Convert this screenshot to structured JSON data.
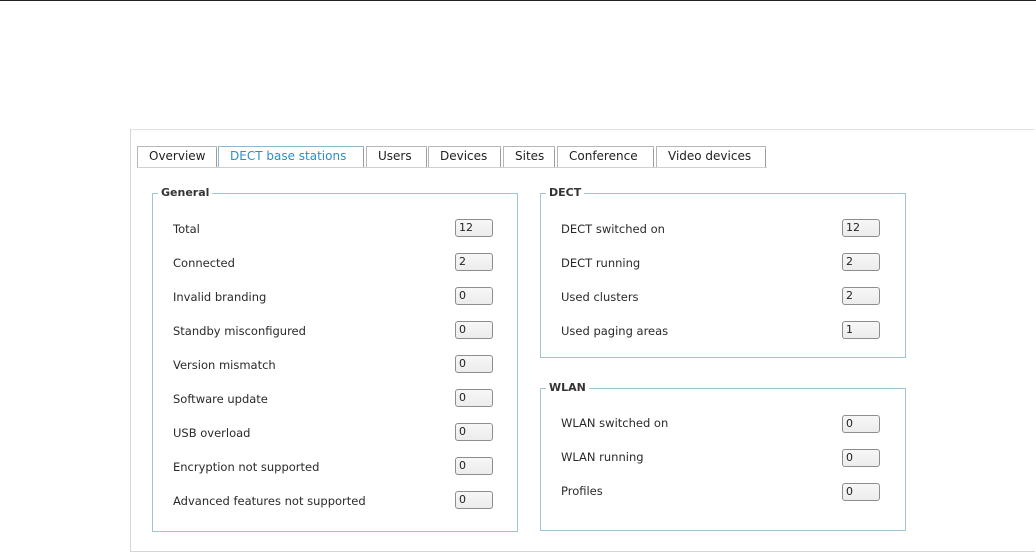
{
  "tabs": [
    {
      "label": "Overview",
      "active": false
    },
    {
      "label": "DECT base stations",
      "active": true
    },
    {
      "label": "Users",
      "active": false
    },
    {
      "label": "Devices",
      "active": false
    },
    {
      "label": "Sites",
      "active": false
    },
    {
      "label": "Conference",
      "active": false
    },
    {
      "label": "Video devices",
      "active": false
    }
  ],
  "general": {
    "title": "General",
    "rows": [
      {
        "label": "Total",
        "value": "12"
      },
      {
        "label": "Connected",
        "value": "2"
      },
      {
        "label": "Invalid branding",
        "value": "0"
      },
      {
        "label": "Standby misconfigured",
        "value": "0"
      },
      {
        "label": "Version mismatch",
        "value": "0"
      },
      {
        "label": "Software update",
        "value": "0"
      },
      {
        "label": "USB overload",
        "value": "0"
      },
      {
        "label": "Encryption not supported",
        "value": "0"
      },
      {
        "label": "Advanced features not supported",
        "value": "0"
      }
    ]
  },
  "dect": {
    "title": "DECT",
    "rows": [
      {
        "label": "DECT switched on",
        "value": "12"
      },
      {
        "label": "DECT running",
        "value": "2"
      },
      {
        "label": "Used clusters",
        "value": "2"
      },
      {
        "label": "Used paging areas",
        "value": "1"
      }
    ]
  },
  "wlan": {
    "title": "WLAN",
    "rows": [
      {
        "label": "WLAN switched on",
        "value": "0"
      },
      {
        "label": "WLAN running",
        "value": "0"
      },
      {
        "label": "Profiles",
        "value": "0"
      }
    ]
  },
  "colors": {
    "accent": "#2a8fc8",
    "group_border": "#9fc4d6"
  }
}
